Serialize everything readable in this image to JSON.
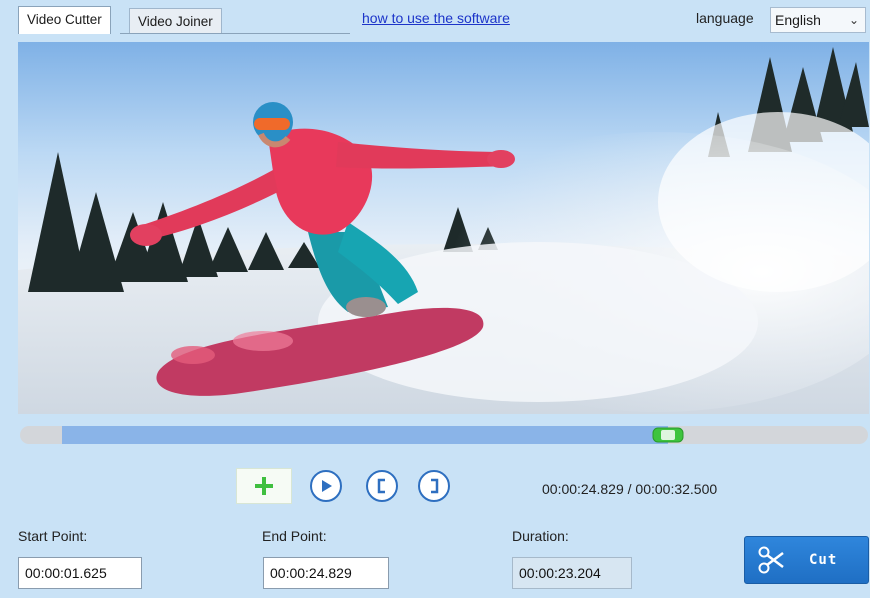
{
  "tabs": [
    {
      "label": "Video Cutter",
      "active": true
    },
    {
      "label": "Video Joiner",
      "active": false
    }
  ],
  "help_link": "how to use the software",
  "language": {
    "label": "language",
    "selected": "English"
  },
  "player": {
    "current_time": "00:00:24.829",
    "total_time": "00:00:32.500",
    "time_display": "00:00:24.829 / 00:00:32.500",
    "progress_fraction": 0.764,
    "selection_start_fraction": 0.05,
    "selection_end_fraction": 0.764
  },
  "controls": {
    "add_icon": "plus-icon",
    "play_icon": "play-icon",
    "set_start_icon": "bracket-left-icon",
    "set_end_icon": "bracket-right-icon"
  },
  "fields": {
    "start_label": "Start Point:",
    "start_value": "00:00:01.625",
    "end_label": "End Point:",
    "end_value": "00:00:24.829",
    "duration_label": "Duration:",
    "duration_value": "00:00:23.204"
  },
  "cut_button": {
    "label": "Cut",
    "icon": "scissors-icon"
  },
  "colors": {
    "background": "#c9e2f6",
    "accent": "#2e6fc0",
    "timeline_range": "#8ab4e8",
    "handle_green": "#3ec43e"
  }
}
